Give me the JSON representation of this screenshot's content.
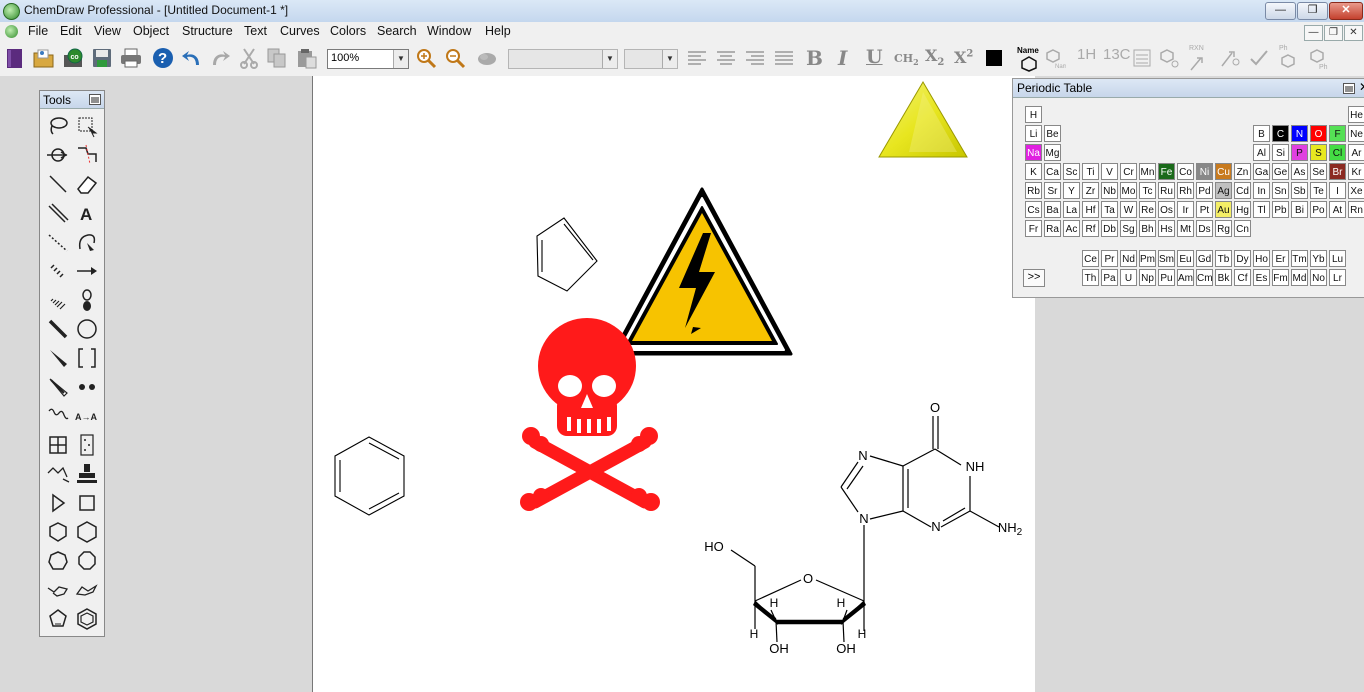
{
  "window": {
    "title": "ChemDraw Professional - [Untitled Document-1 *]",
    "minimize": "—",
    "restore": "❐",
    "close": "✕"
  },
  "menu": [
    "File",
    "Edit",
    "View",
    "Object",
    "Structure",
    "Text",
    "Curves",
    "Colors",
    "Search",
    "Window",
    "Help"
  ],
  "toolbar": {
    "zoom": "100%",
    "bold": "B",
    "italic": "I",
    "underline": "U",
    "ch2": "CH",
    "ch2_sub": "2",
    "subscript": "X",
    "subscript_sub": "2",
    "superscript": "X",
    "superscript_sup": "2",
    "name_label": "Name",
    "h_nmr": "1H",
    "c_nmr": "13C",
    "rxn": "RXN",
    "ph": "Ph",
    "ph2": "Ph"
  },
  "tools_palette": {
    "title": "Tools"
  },
  "periodic_table": {
    "title": "Periodic Table",
    "more_button": ">>",
    "main": [
      [
        "H",
        "",
        "",
        "",
        "",
        "",
        "",
        "",
        "",
        "",
        "",
        "",
        "",
        "",
        "",
        "",
        "",
        "He"
      ],
      [
        "Li",
        "Be",
        "",
        "",
        "",
        "",
        "",
        "",
        "",
        "",
        "",
        "",
        "B",
        "C",
        "N",
        "O",
        "F",
        "Ne"
      ],
      [
        "Na",
        "Mg",
        "",
        "",
        "",
        "",
        "",
        "",
        "",
        "",
        "",
        "",
        "Al",
        "Si",
        "P",
        "S",
        "Cl",
        "Ar"
      ],
      [
        "K",
        "Ca",
        "Sc",
        "Ti",
        "V",
        "Cr",
        "Mn",
        "Fe",
        "Co",
        "Ni",
        "Cu",
        "Zn",
        "Ga",
        "Ge",
        "As",
        "Se",
        "Br",
        "Kr"
      ],
      [
        "Rb",
        "Sr",
        "Y",
        "Zr",
        "Nb",
        "Mo",
        "Tc",
        "Ru",
        "Rh",
        "Pd",
        "Ag",
        "Cd",
        "In",
        "Sn",
        "Sb",
        "Te",
        "I",
        "Xe"
      ],
      [
        "Cs",
        "Ba",
        "La",
        "Hf",
        "Ta",
        "W",
        "Re",
        "Os",
        "Ir",
        "Pt",
        "Au",
        "Hg",
        "Tl",
        "Pb",
        "Bi",
        "Po",
        "At",
        "Rn"
      ],
      [
        "Fr",
        "Ra",
        "Ac",
        "Rf",
        "Db",
        "Sg",
        "Bh",
        "Hs",
        "Mt",
        "Ds",
        "Rg",
        "Cn"
      ]
    ],
    "lanthanides": [
      "Ce",
      "Pr",
      "Nd",
      "Pm",
      "Sm",
      "Eu",
      "Gd",
      "Tb",
      "Dy",
      "Ho",
      "Er",
      "Tm",
      "Yb",
      "Lu"
    ],
    "actinides": [
      "Th",
      "Pa",
      "U",
      "Np",
      "Pu",
      "Am",
      "Cm",
      "Bk",
      "Cf",
      "Es",
      "Fm",
      "Md",
      "No",
      "Lr"
    ],
    "highlight_colors": {
      "C": "#000000",
      "N": "#0000ff",
      "O": "#ff0000",
      "F": "#55e055",
      "Na": "#e020e0",
      "P": "#e040e0",
      "S": "#e8e820",
      "Cl": "#44dd44",
      "Fe": "#1a6a1a",
      "Ni": "#888888",
      "Cu": "#c87a1e",
      "Br": "#8b2a22",
      "Ag": "#c0c0c0",
      "Au": "#f4ee66"
    }
  },
  "molecule": {
    "atoms": {
      "carbonyl_O": "O",
      "nh": "NH",
      "n7": "N",
      "n9": "N",
      "n3": "N",
      "nh2": "NH",
      "nh2_sub": "2",
      "ring_O": "O",
      "ho": "HO",
      "oh_left": "OH",
      "oh_right": "OH",
      "h1": "H",
      "h2": "H",
      "h3": "H",
      "h4": "H"
    }
  }
}
